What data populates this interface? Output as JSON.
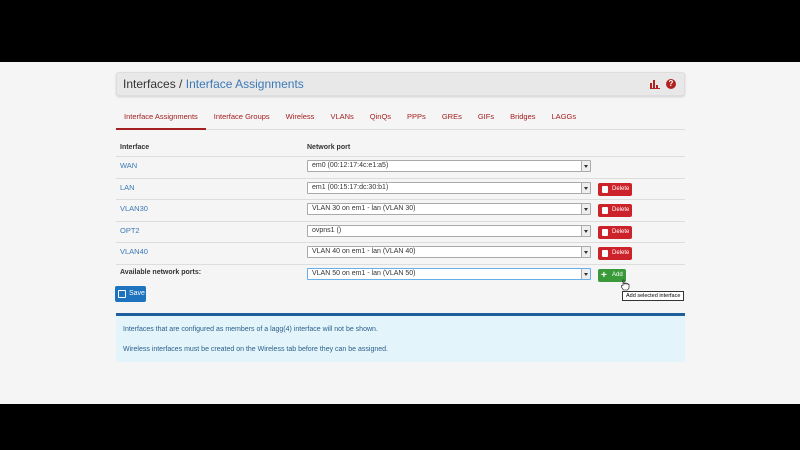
{
  "breadcrumb": {
    "parent": "Interfaces",
    "separator": "/",
    "current": "Interface Assignments"
  },
  "tabs": [
    {
      "label": "Interface Assignments",
      "active": true
    },
    {
      "label": "Interface Groups"
    },
    {
      "label": "Wireless"
    },
    {
      "label": "VLANs"
    },
    {
      "label": "QinQs"
    },
    {
      "label": "PPPs"
    },
    {
      "label": "GREs"
    },
    {
      "label": "GIFs"
    },
    {
      "label": "Bridges"
    },
    {
      "label": "LAGGs"
    }
  ],
  "table": {
    "col_interface": "Interface",
    "col_port": "Network port",
    "rows": [
      {
        "name": "WAN",
        "port": "em0 (00:12:17:4c:e1:a5)"
      },
      {
        "name": "LAN",
        "port": "em1 (00:15:17:dc:30:b1)",
        "delete": "Delete"
      },
      {
        "name": "VLAN30",
        "port": "VLAN 30 on em1 - lan (VLAN 30)",
        "delete": "Delete"
      },
      {
        "name": "OPT2",
        "port": "ovpns1 ()",
        "delete": "Delete"
      },
      {
        "name": "VLAN40",
        "port": "VLAN 40 on em1 - lan (VLAN 40)",
        "delete": "Delete"
      }
    ],
    "available_label": "Available network ports:",
    "available_value": "VLAN 50 on em1 - lan (VLAN 50)",
    "add_label": "Add",
    "add_tooltip": "Add selected interface"
  },
  "save_label": "Save",
  "info": {
    "line1": "Interfaces that are configured as members of a lagg(4) interface will not be shown.",
    "line2": "Wireless interfaces must be created on the Wireless tab before they can be assigned."
  },
  "colors": {
    "accent": "#a32020",
    "link": "#3b79b6",
    "delete": "#cc2229",
    "add": "#3a9a3a",
    "save": "#1e73be"
  }
}
